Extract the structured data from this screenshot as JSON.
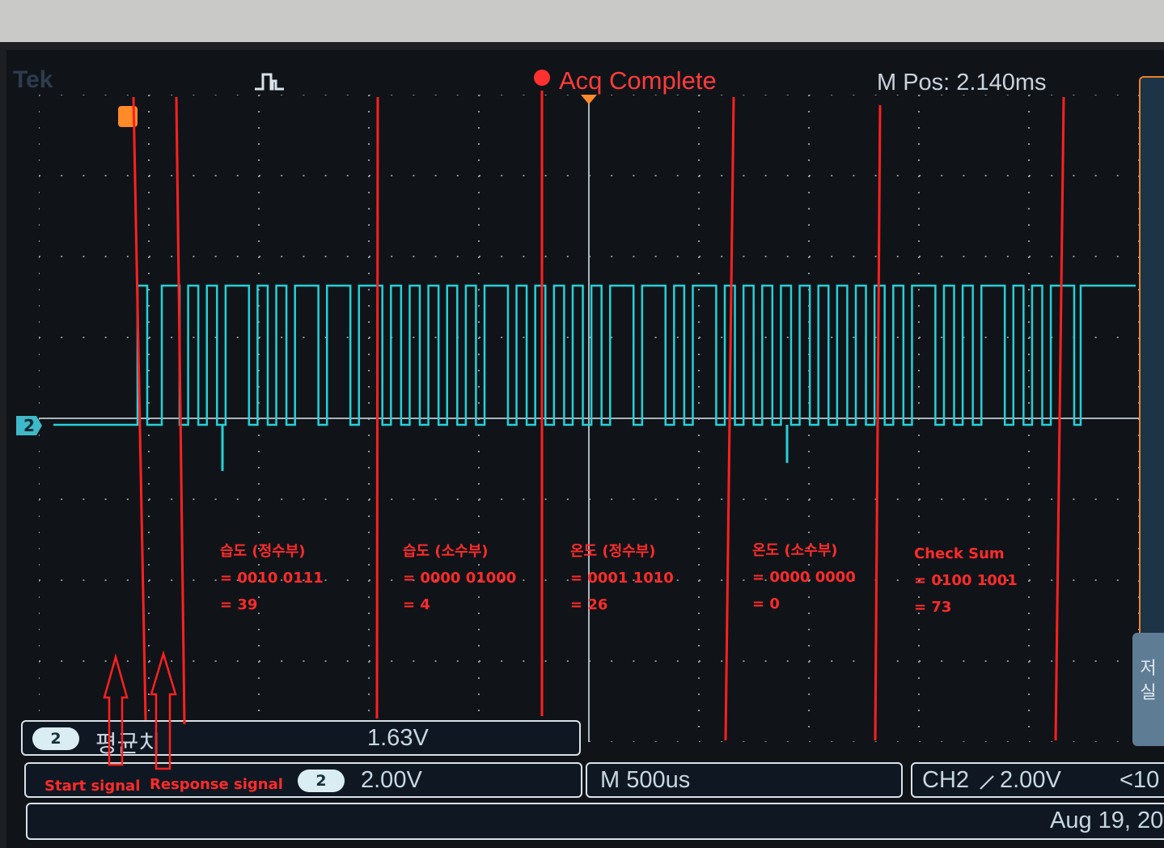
{
  "scope": {
    "brand": "Tek",
    "acquisition_status": "Acq Complete",
    "horizontal_position": "M Pos: 2.140ms",
    "channel_marker": "2",
    "measurement_channel": "2",
    "measurement_label": "평균치",
    "measurement_value": "1.63V",
    "vertical_channel": "2",
    "vertical_scale": "2.00V",
    "timebase": "M 500us",
    "trigger_source": "CH2",
    "trigger_level": "2.00V",
    "trigger_extra": "<10",
    "date": "Aug 19, 20",
    "side_tab_text": [
      "저",
      "실"
    ]
  },
  "annotations": {
    "start_signal": "Start signal",
    "response_signal": "Response signal",
    "groups": [
      {
        "title": "습도 (정수부)",
        "binary": "= 0010 0111",
        "decimal": "= 39"
      },
      {
        "title": "습도 (소수부)",
        "binary": "= 0000 01000",
        "decimal": "= 4"
      },
      {
        "title": "온도 (정수부)",
        "binary": "= 0001 1010",
        "decimal": "= 26"
      },
      {
        "title": "온도 (소수부)",
        "binary": "= 0000 0000",
        "decimal": "= 0"
      },
      {
        "title": "Check Sum",
        "binary": "= 0100 1001",
        "decimal": "= 73"
      }
    ]
  },
  "colors": {
    "trace": "#26d0d8",
    "annotation_red": "#ff2020",
    "grid_dots": "#8a9299",
    "status_red": "#ff3b3b"
  },
  "signal": {
    "bits_msb_first": "0010011100000100000110100000000001001001"
  }
}
